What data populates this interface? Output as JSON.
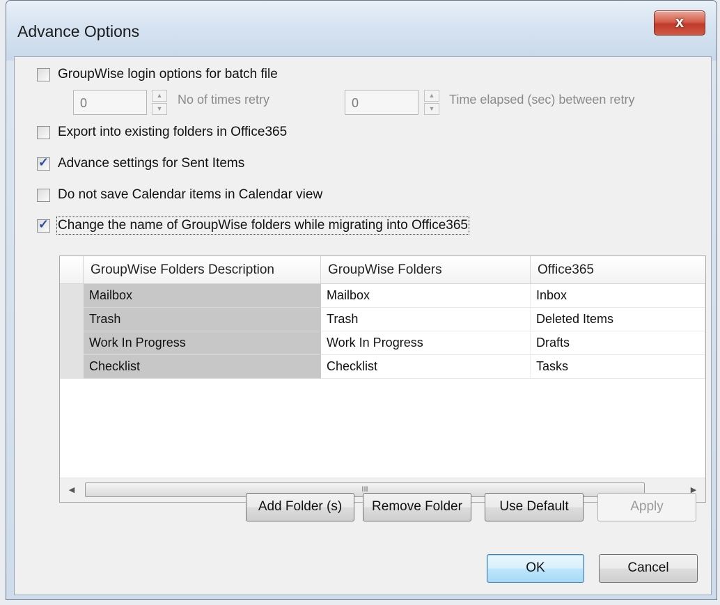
{
  "window": {
    "title": "Advance Options",
    "close_glyph": "x"
  },
  "options": {
    "batch_login": {
      "label": "GroupWise login options for batch file",
      "checked": false
    },
    "retry_count": {
      "value": "0",
      "label": "No of times retry"
    },
    "retry_interval": {
      "value": "0",
      "label": "Time elapsed (sec) between retry"
    },
    "export_existing": {
      "label": "Export into existing folders in Office365",
      "checked": false
    },
    "sent_items": {
      "label": "Advance settings for Sent Items",
      "checked": true
    },
    "calendar_view": {
      "label": "Do not save Calendar items in Calendar view",
      "checked": false
    },
    "rename_folders": {
      "label": "Change the name of GroupWise folders while migrating into Office365",
      "checked": true
    }
  },
  "grid": {
    "columns": [
      "GroupWise Folders Description",
      "GroupWise Folders",
      "Office365"
    ],
    "rows": [
      [
        "Mailbox",
        "Mailbox",
        "Inbox"
      ],
      [
        "Trash",
        "Trash",
        "Deleted Items"
      ],
      [
        "Work In Progress",
        "Work In Progress",
        "Drafts"
      ],
      [
        "Checklist",
        "Checklist",
        "Tasks"
      ]
    ],
    "scroll_grip": "III",
    "left_arrow": "◀",
    "right_arrow": "▶"
  },
  "buttons": {
    "add_folder": "Add Folder (s)",
    "remove_folder": "Remove Folder",
    "use_default": "Use Default",
    "apply": "Apply",
    "ok": "OK",
    "cancel": "Cancel"
  },
  "icons": {
    "check_glyph": "✓",
    "spin_up": "▲",
    "spin_down": "▼"
  }
}
